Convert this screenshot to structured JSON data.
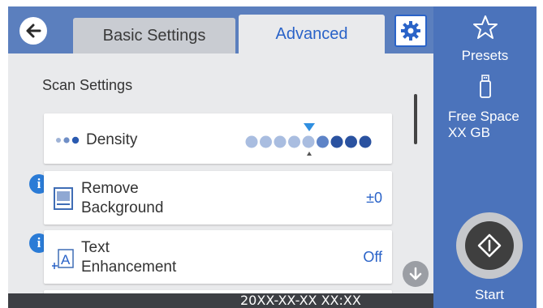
{
  "tabs": {
    "basic_label": "Basic Settings",
    "advanced_label": "Advanced"
  },
  "content": {
    "section_title": "Scan Settings",
    "density": {
      "label": "Density",
      "level": 6,
      "levels_total": 9
    },
    "remove_background": {
      "label_line1": "Remove",
      "label_line2": "Background",
      "value": "±0"
    },
    "text_enhancement": {
      "label_line1": "Text",
      "label_line2": "Enhancement",
      "value": "Off"
    }
  },
  "sidebar": {
    "presets_label": "Presets",
    "free_space_line1": "Free Space",
    "free_space_line2": "XX GB",
    "start_label": "Start"
  },
  "status": {
    "datetime": "20XX-XX-XX XX:XX"
  },
  "icons": {
    "back": "arrow-left-icon",
    "settings": "gear-icon",
    "presets": "star-icon",
    "usb": "usb-drive-icon",
    "start": "diamond-start-icon",
    "info": "info-icon",
    "scroll_down": "arrow-down-icon"
  },
  "colors": {
    "accent": "#2a63c8",
    "header": "#5b7fbe",
    "sidebar": "#4b73bb"
  }
}
